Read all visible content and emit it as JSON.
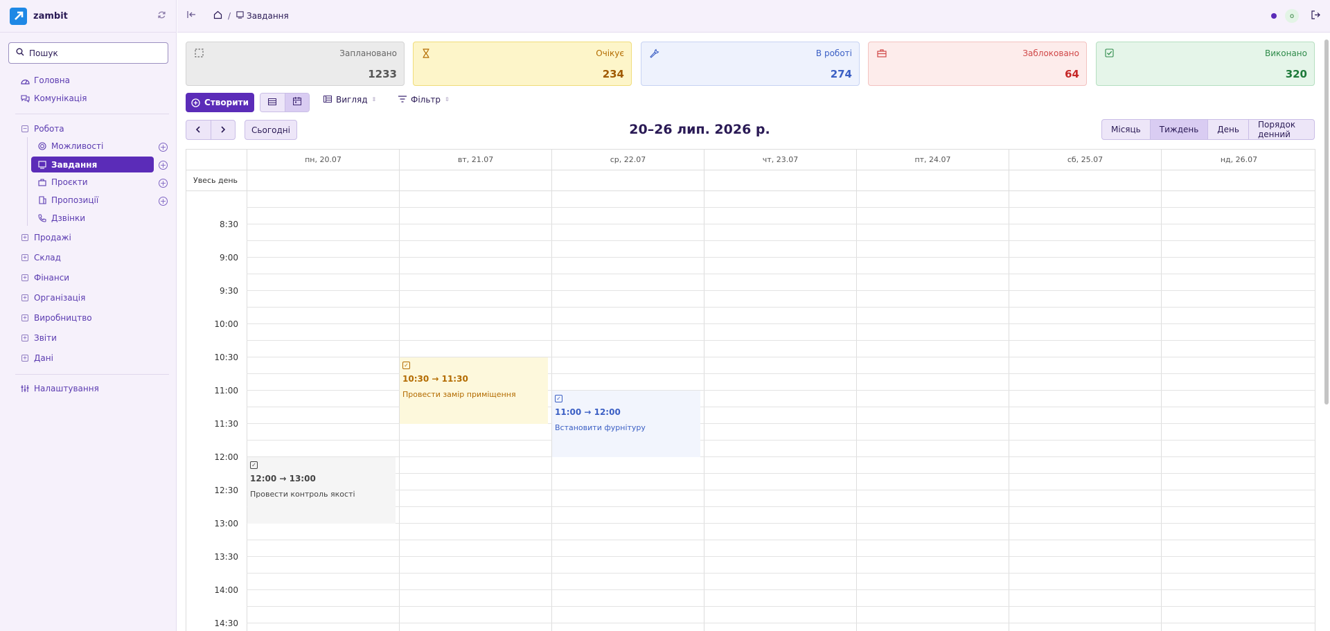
{
  "app": {
    "brand": "zambit"
  },
  "sidebar": {
    "search_label": "Пошук",
    "items": [
      {
        "label": "Головна"
      },
      {
        "label": "Комунікація"
      },
      {
        "label": "Робота"
      },
      {
        "label": "Можливості"
      },
      {
        "label": "Завдання"
      },
      {
        "label": "Проєкти"
      },
      {
        "label": "Пропозиції"
      },
      {
        "label": "Дзвінки"
      },
      {
        "label": "Продажі"
      },
      {
        "label": "Склад"
      },
      {
        "label": "Фінанси"
      },
      {
        "label": "Організація"
      },
      {
        "label": "Виробництво"
      },
      {
        "label": "Звіти"
      },
      {
        "label": "Дані"
      },
      {
        "label": "Налаштування"
      }
    ]
  },
  "topbar": {
    "breadcrumb": "Завдання",
    "avatar_letter": "o"
  },
  "stats": [
    {
      "label": "Заплановано",
      "value": "1233"
    },
    {
      "label": "Очікує",
      "value": "234"
    },
    {
      "label": "В роботі",
      "value": "274"
    },
    {
      "label": "Заблоковано",
      "value": "64"
    },
    {
      "label": "Виконано",
      "value": "320"
    }
  ],
  "toolbar": {
    "create_label": "Створити",
    "view_label": "Вигляд",
    "filter_label": "Фільтр",
    "today_label": "Сьогодні"
  },
  "calendar": {
    "range_title": "20–26 лип. 2026 р.",
    "views": [
      "Місяць",
      "Тиждень",
      "День",
      "Порядок денний"
    ],
    "active_view": "Тиждень",
    "days": [
      "пн, 20.07",
      "вт, 21.07",
      "ср, 22.07",
      "чт, 23.07",
      "пт, 24.07",
      "сб, 25.07",
      "нд, 26.07"
    ],
    "allday_label": "Увесь день",
    "times": [
      "8:30",
      "9:00",
      "9:30",
      "10:00",
      "10:30",
      "11:00",
      "11:30",
      "12:00",
      "12:30",
      "13:00",
      "13:30",
      "14:00",
      "14:30"
    ],
    "events": [
      {
        "time": "10:30 → 11:30",
        "title": "Провести замір приміщення"
      },
      {
        "time": "11:00 → 12:00",
        "title": "Встановити фурнітуру"
      },
      {
        "time": "12:00 → 13:00",
        "title": "Провести контроль якості"
      }
    ]
  }
}
